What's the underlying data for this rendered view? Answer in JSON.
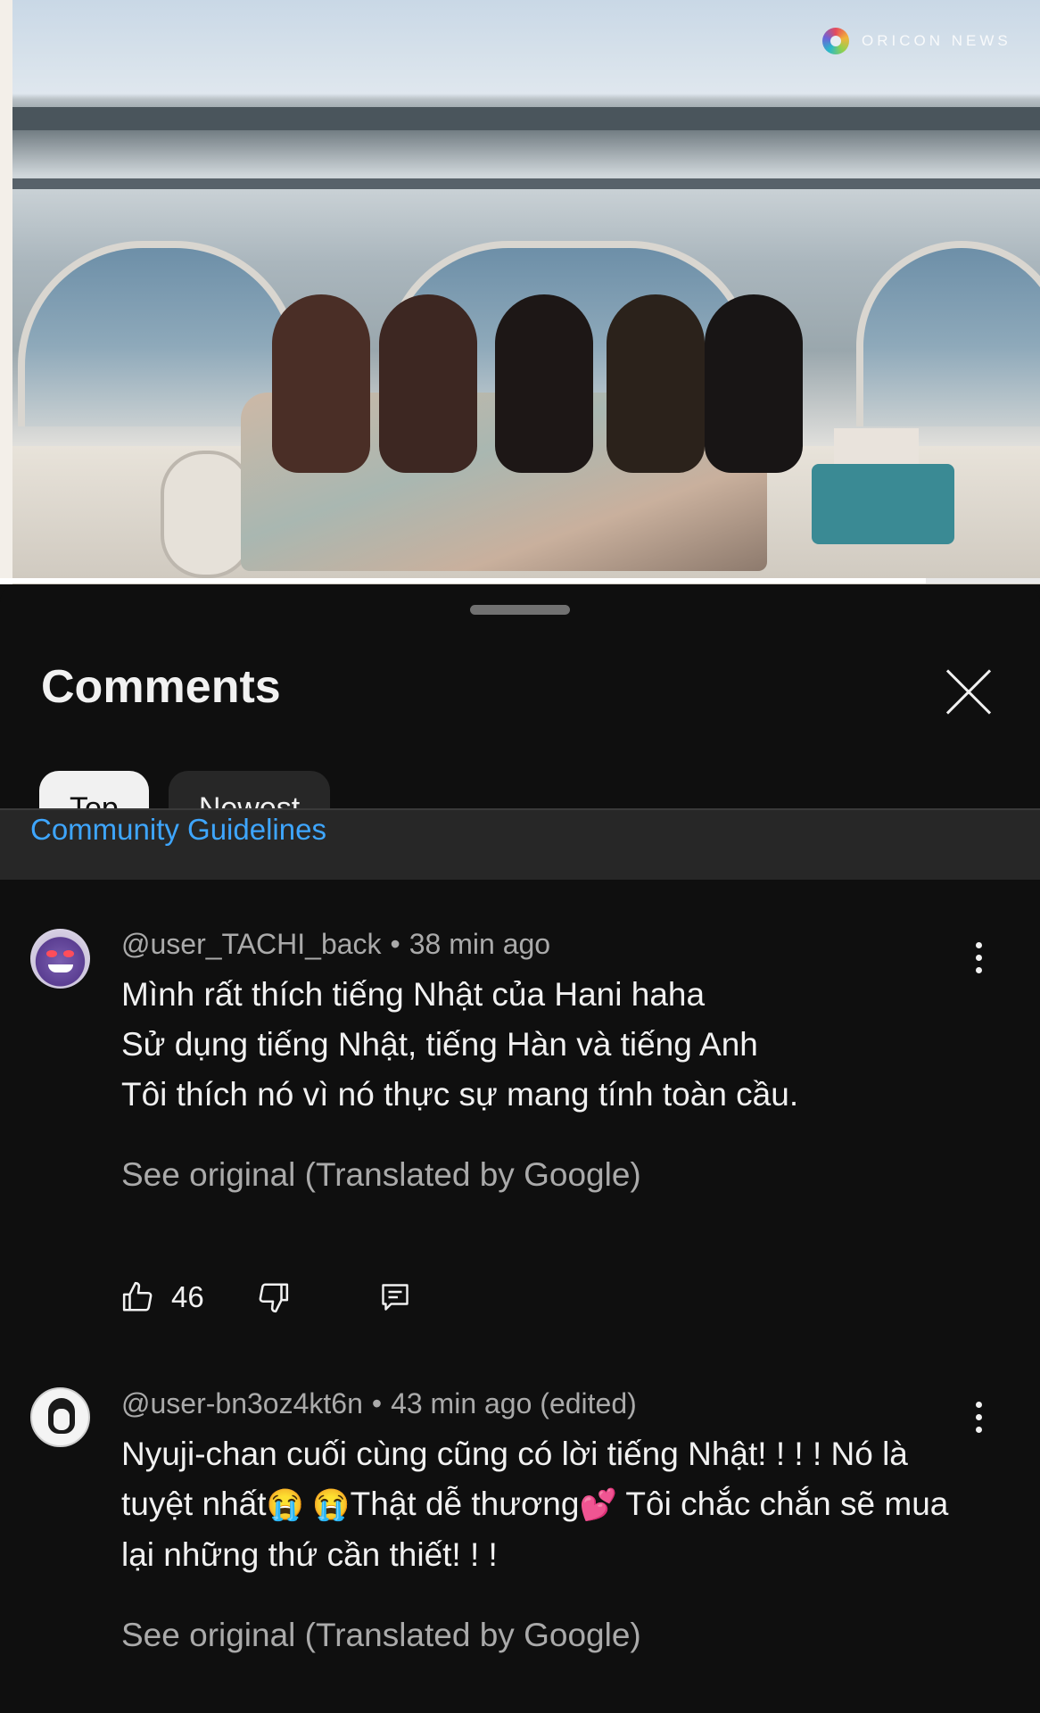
{
  "video": {
    "watermark": "ORICON NEWS",
    "watermark_icon": "oricon-flower-logo",
    "progress_fraction": 0.89
  },
  "comments_sheet": {
    "title": "Comments",
    "close_icon": "close-icon",
    "filters": [
      {
        "label": "Top",
        "selected": true
      },
      {
        "label": "Newest",
        "selected": false
      }
    ],
    "guidelines_link": "Community Guidelines"
  },
  "comments": [
    {
      "author": "@user_TACHI_back",
      "separator": "•",
      "time": "38 min ago",
      "avatar": "gengar-avatar",
      "text": "Mình rất thích tiếng Nhật của Hani haha\nSử dụng tiếng Nhật, tiếng Hàn và tiếng Anh\nTôi thích nó vì nó thực sự mang tính toàn cầu.",
      "see_original": "See original (Translated by Google)",
      "likes": "46"
    },
    {
      "author": "@user-bn3oz4kt6n",
      "separator": "•",
      "time": "43 min ago (edited)",
      "avatar": "manga-sketch-avatar",
      "text_part1": "Nyuji-chan cuối cùng cũng có lời tiếng Nhật! ! ! ! Nó là tuyệt nhất",
      "emoji_cry": "😭 😭",
      "text_part2": "Thật dễ thương",
      "emoji_hearts": "💕",
      "text_part3": " Tôi chắc chắn sẽ mua lại những thứ cần thiết! ! !",
      "see_original": "See original (Translated by Google)"
    }
  ]
}
